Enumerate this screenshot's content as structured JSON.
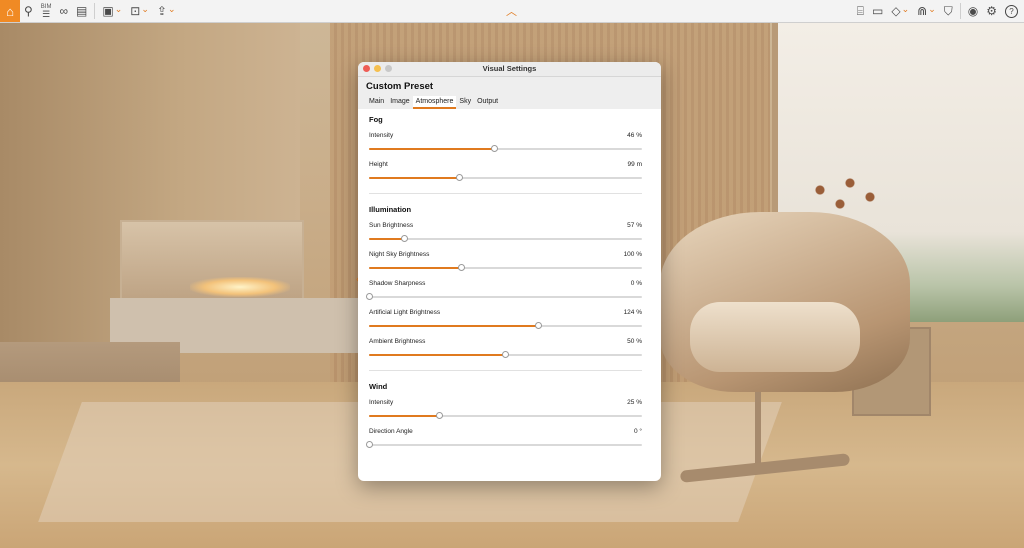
{
  "window": {
    "title": "Visual Settings"
  },
  "toolbar": {
    "bim_label": "BIM",
    "accent": "#f08a24",
    "left_icons": [
      "home-icon",
      "pin-icon",
      "bim-icon",
      "binoculars-icon",
      "clapper-icon",
      "export-image-icon",
      "export-video-icon",
      "share-icon"
    ],
    "right_icons": [
      "map-icon",
      "presentation-icon",
      "cube-icon",
      "material-icon",
      "paint-icon",
      "eye-icon",
      "gear-icon",
      "help-icon"
    ]
  },
  "dialog": {
    "preset": "Custom Preset",
    "tabs": [
      "Main",
      "Image",
      "Atmosphere",
      "Sky",
      "Output"
    ],
    "active_tab": "Atmosphere",
    "fog": {
      "title": "Fog",
      "rows": [
        {
          "label": "Intensity",
          "value": "46 %",
          "level": 0.46
        },
        {
          "label": "Height",
          "value": "99 m",
          "level": 0.33
        }
      ]
    },
    "illumination": {
      "title": "Illumination",
      "rows": [
        {
          "label": "Sun Brightness",
          "value": "57 %",
          "level": 0.13
        },
        {
          "label": "Night Sky Brightness",
          "value": "100 %",
          "level": 0.34
        },
        {
          "label": "Shadow Sharpness",
          "value": "0 %",
          "level": 0.0
        },
        {
          "label": "Artificial Light Brightness",
          "value": "124 %",
          "level": 0.62
        },
        {
          "label": "Ambient Brightness",
          "value": "50 %",
          "level": 0.5
        }
      ]
    },
    "wind": {
      "title": "Wind",
      "rows": [
        {
          "label": "Intensity",
          "value": "25 %",
          "level": 0.26
        },
        {
          "label": "Direction Angle",
          "value": "0 °",
          "level": 0.0
        }
      ]
    }
  },
  "colors": {
    "accent": "#e07a1f",
    "close": "#ee5d56",
    "minimize": "#f5bf4f",
    "zoom": "#c8c8c8"
  }
}
